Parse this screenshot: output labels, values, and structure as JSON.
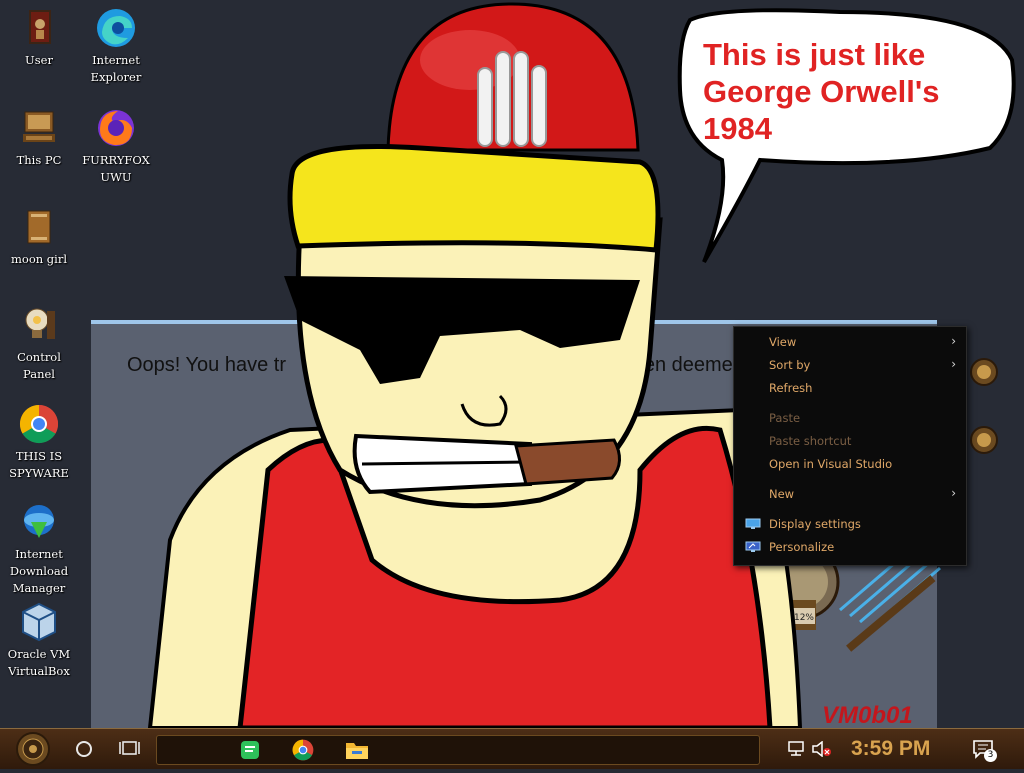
{
  "desktop": {
    "icons": [
      {
        "label": "User",
        "icon": "user-folder-icon"
      },
      {
        "label": "Internet\nExplorer",
        "icon": "edge-icon"
      },
      {
        "label": "This PC",
        "icon": "computer-icon"
      },
      {
        "label": "FURRYFOX\nUWU",
        "icon": "firefox-icon"
      },
      {
        "label": "moon girl",
        "icon": "file-icon"
      },
      {
        "label": "Control Panel",
        "icon": "lightbulb-icon"
      },
      {
        "label": "THIS IS\nSPYWARE",
        "icon": "chrome-icon"
      },
      {
        "label": "Internet\nDownload\nManager",
        "icon": "download-manager-icon"
      },
      {
        "label": "Oracle VM\nVirtualBox",
        "icon": "virtualbox-icon"
      }
    ]
  },
  "window": {
    "message_left": "Oops! You have tr",
    "message_right": "s been deeme"
  },
  "meme": {
    "bubble_text": "This is just like\nGeorge Orwell's\n1984",
    "hat_color": "#f5e51c",
    "shirt_color": "#e32426",
    "skin_color": "#fbf2b8"
  },
  "context_menu": {
    "items": [
      {
        "label": "View",
        "submenu": true,
        "enabled": true
      },
      {
        "label": "Sort by",
        "submenu": true,
        "enabled": true
      },
      {
        "label": "Refresh",
        "submenu": false,
        "enabled": true
      },
      {
        "label": "Paste",
        "submenu": false,
        "enabled": false
      },
      {
        "label": "Paste shortcut",
        "submenu": false,
        "enabled": false
      },
      {
        "label": "Open in Visual Studio",
        "submenu": false,
        "enabled": true
      },
      {
        "label": "New",
        "submenu": true,
        "enabled": true
      },
      {
        "label": "Display settings",
        "submenu": false,
        "enabled": true,
        "icon": "display-icon"
      },
      {
        "label": "Personalize",
        "submenu": false,
        "enabled": true,
        "icon": "personalize-icon"
      }
    ],
    "text_color": "#e0a868"
  },
  "gadget": {
    "percent": "12%",
    "watermark": "VM0b01"
  },
  "taskbar": {
    "time": "3:59 PM",
    "notification_count": "3",
    "pinned": [
      "notes-app-icon",
      "chrome-icon",
      "file-explorer-icon"
    ],
    "accent": "#d9a34f"
  }
}
